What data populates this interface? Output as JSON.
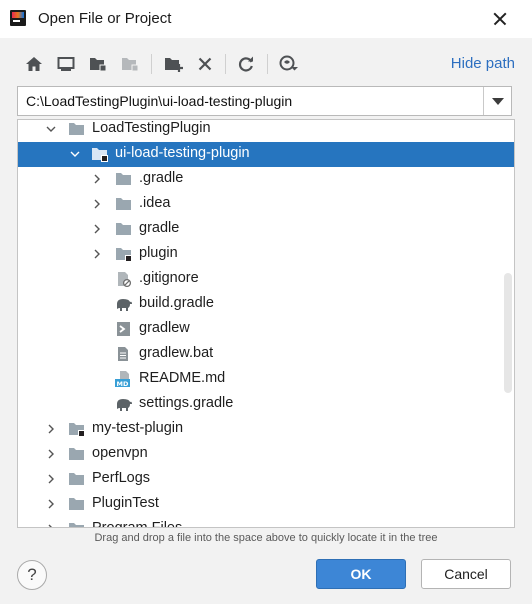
{
  "window": {
    "title": "Open File or Project"
  },
  "toolbar": {
    "hide_path_label": "Hide path"
  },
  "path": {
    "value": "C:\\LoadTestingPlugin\\ui-load-testing-plugin"
  },
  "tree": {
    "items": [
      {
        "label": "LoadTestingPlugin",
        "icon": "folder-icon",
        "state": "expanded"
      },
      {
        "label": "ui-load-testing-plugin",
        "icon": "module-folder-icon",
        "state": "expanded",
        "selected": true
      },
      {
        "label": ".gradle",
        "icon": "folder-icon",
        "state": "collapsed"
      },
      {
        "label": ".idea",
        "icon": "folder-icon",
        "state": "collapsed"
      },
      {
        "label": "gradle",
        "icon": "folder-icon",
        "state": "collapsed"
      },
      {
        "label": "plugin",
        "icon": "module-folder-icon",
        "state": "collapsed"
      },
      {
        "label": ".gitignore",
        "icon": "ignored-file-icon",
        "state": "leaf"
      },
      {
        "label": "build.gradle",
        "icon": "gradle-elephant-icon",
        "state": "leaf"
      },
      {
        "label": "gradlew",
        "icon": "shell-script-icon",
        "state": "leaf"
      },
      {
        "label": "gradlew.bat",
        "icon": "text-file-icon",
        "state": "leaf"
      },
      {
        "label": "README.md",
        "icon": "markdown-file-icon",
        "state": "leaf"
      },
      {
        "label": "settings.gradle",
        "icon": "gradle-elephant-icon",
        "state": "leaf"
      },
      {
        "label": "my-test-plugin",
        "icon": "module-folder-icon",
        "state": "collapsed"
      },
      {
        "label": "openvpn",
        "icon": "folder-icon",
        "state": "collapsed"
      },
      {
        "label": "PerfLogs",
        "icon": "folder-icon",
        "state": "collapsed"
      },
      {
        "label": "PluginTest",
        "icon": "folder-icon",
        "state": "collapsed"
      },
      {
        "label": "Program Files",
        "icon": "folder-icon",
        "state": "collapsed"
      }
    ]
  },
  "hint": "Drag and drop a file into the space above to quickly locate it in the tree",
  "buttons": {
    "help": "?",
    "ok": "OK",
    "cancel": "Cancel"
  },
  "colors": {
    "selection": "#2675bf",
    "accent_link": "#2d6fc0",
    "ok_button": "#3d86d6",
    "folder": "#9aa7b0"
  }
}
